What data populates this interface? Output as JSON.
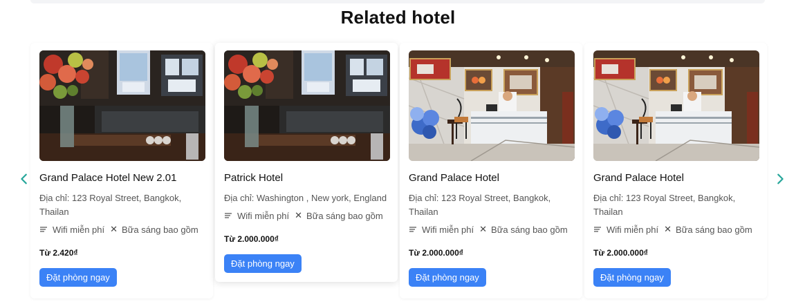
{
  "section": {
    "title": "Related hotel"
  },
  "nav": {
    "prev_icon": "chevron-left-icon",
    "next_icon": "chevron-right-icon",
    "accent": "#26a69a"
  },
  "colors": {
    "button": "#3b82f6"
  },
  "hotels": [
    {
      "name": "Grand Palace Hotel New 2.01",
      "address": "Địa chỉ: 123 Royal Street, Bangkok, Thailan",
      "amenity_1": "Wifi miễn phí",
      "amenity_2": "Bữa sáng bao gồm",
      "price": "Từ 2.420₫",
      "book_label": "Đặt phòng ngay",
      "photo": "lobby-flowers-photo"
    },
    {
      "name": "Patrick Hotel",
      "address": "Địa chỉ: Washington , New york, England",
      "amenity_1": "Wifi miễn phí",
      "amenity_2": "Bữa sáng bao gồm",
      "price": "Từ 2.000.000₫",
      "book_label": "Đặt phòng ngay",
      "photo": "lobby-flowers-photo"
    },
    {
      "name": "Grand Palace Hotel",
      "address": "Địa chỉ: 123 Royal Street, Bangkok, Thailan",
      "amenity_1": "Wifi miễn phí",
      "amenity_2": "Bữa sáng bao gồm",
      "price": "Từ 2.000.000₫",
      "book_label": "Đặt phòng ngay",
      "photo": "reception-desk-photo"
    },
    {
      "name": "Grand Palace Hotel",
      "address": "Địa chỉ: 123 Royal Street, Bangkok, Thailan",
      "amenity_1": "Wifi miễn phí",
      "amenity_2": "Bữa sáng bao gồm",
      "price": "Từ 2.000.000₫",
      "book_label": "Đặt phòng ngay",
      "photo": "reception-desk-photo"
    }
  ]
}
